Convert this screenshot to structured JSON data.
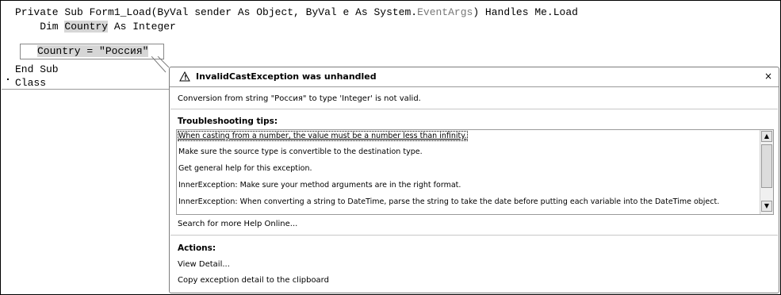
{
  "code": {
    "line1": {
      "part1": "Private Sub Form1_Load(ByVal sender As Object, ByVal e As System.",
      "type_name": "EventArgs",
      "part2": ") Handles Me.Load"
    },
    "line2": {
      "prefix": "    Dim ",
      "var": "Country",
      "suffix": " As Integer"
    },
    "line3": {
      "var": "Country",
      "assign": " = \"Россия\""
    },
    "line4": "End Sub",
    "line5": "Class"
  },
  "assistant": {
    "title": "InvalidCastException was unhandled",
    "message": "Conversion from string \"Россия\" to type 'Integer' is not valid.",
    "tips_title": "Troubleshooting tips:",
    "tips": [
      "When casting from a number, the value must be a number less than infinity.",
      "Make sure the source type is convertible to the destination type.",
      "Get general help for this exception.",
      "InnerException: Make sure your method arguments are in the right format.",
      "InnerException: When converting a string to DateTime, parse the string to take the date before putting each variable into the DateTime object."
    ],
    "search_link": "Search for more Help Online...",
    "actions_title": "Actions:",
    "actions": [
      "View Detail...",
      "Copy exception detail to the clipboard"
    ],
    "close_symbol": "×",
    "warning_icon_symbol": "!"
  },
  "scroll_symbols": {
    "up": "▲",
    "down": "▼"
  }
}
